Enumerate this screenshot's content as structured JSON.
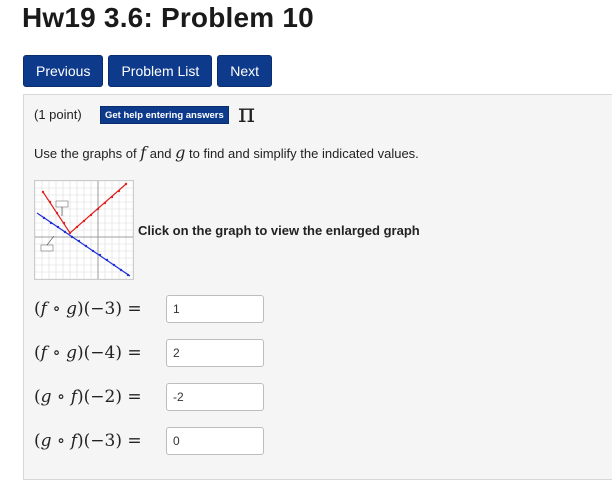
{
  "page": {
    "title": "Hw19 3.6: Problem 10"
  },
  "nav": {
    "previous": "Previous",
    "problem_list": "Problem List",
    "next": "Next"
  },
  "problem": {
    "points": "(1 point)",
    "help_button": "Get help entering answers",
    "pi_symbol": "π",
    "instructions_prefix": "Use the graphs of",
    "var_f": "f",
    "instructions_and": "and",
    "var_g": "g",
    "instructions_suffix": "to find and simplify the indicated values.",
    "enlarge_link": "Click on the graph to view the enlarged graph",
    "graph_labels": {
      "f": "f(x)",
      "g": "g(x)"
    },
    "colors": {
      "f": "#e02020",
      "g": "#1f2fd6"
    },
    "answers": [
      {
        "outer": "f",
        "inner": "g",
        "arg": "−3",
        "value": "1"
      },
      {
        "outer": "f",
        "inner": "g",
        "arg": "−4",
        "value": "2"
      },
      {
        "outer": "g",
        "inner": "f",
        "arg": "−2",
        "value": "-2"
      },
      {
        "outer": "g",
        "inner": "f",
        "arg": "−3",
        "value": "0"
      }
    ]
  }
}
